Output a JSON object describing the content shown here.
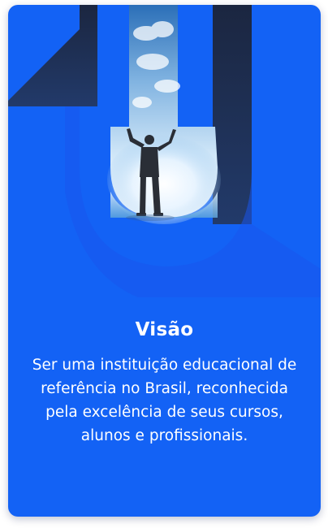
{
  "card": {
    "title": "Visão",
    "body": "Ser uma instituição educacional de referência no Brasil, reconhecida pela excelência de seus cursos, alunos e profissionais.",
    "image_icon": "person-arms-raised-in-doorway-illustration",
    "colors": {
      "card_background": "#1362f5",
      "emblem_dark": "#1d2a45",
      "emblem_blue": "#1a58f0",
      "text": "#ffffff"
    }
  }
}
